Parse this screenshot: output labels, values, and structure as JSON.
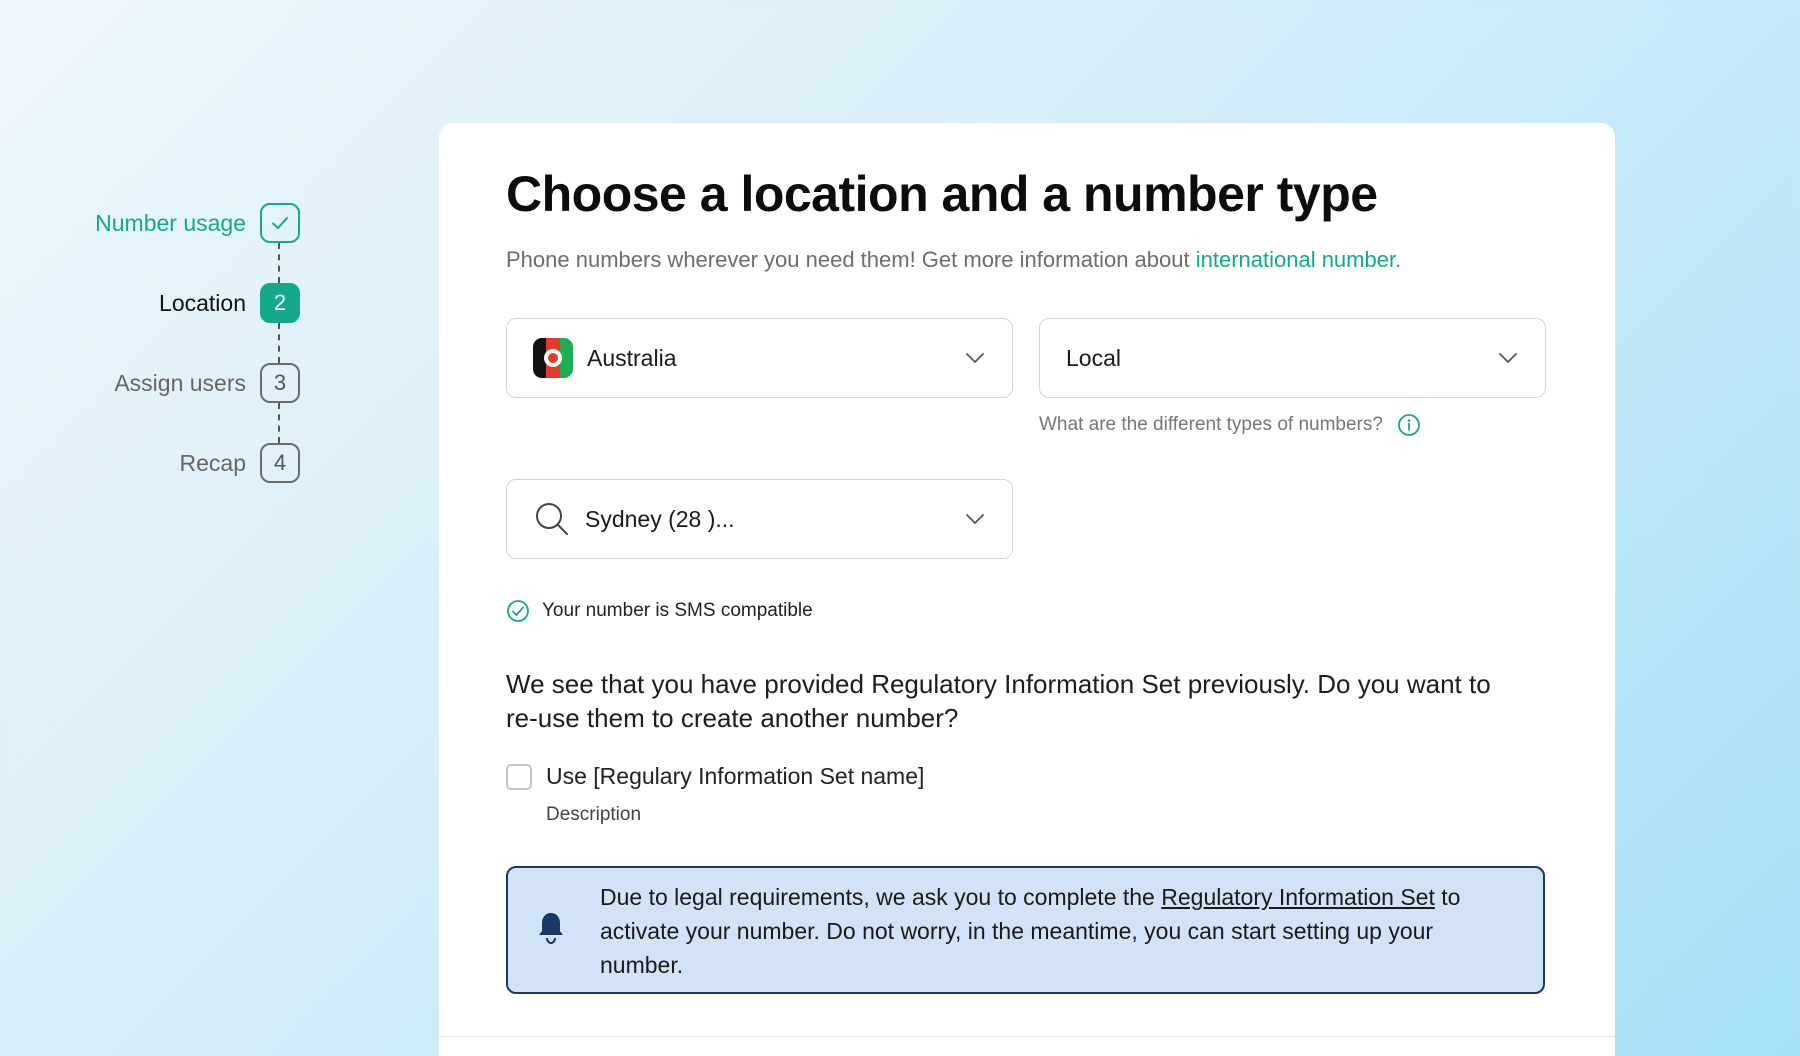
{
  "stepper": {
    "steps": [
      {
        "label": "Number usage",
        "badge": "",
        "state": "done"
      },
      {
        "label": "Location",
        "badge": "2",
        "state": "current"
      },
      {
        "label": "Assign users",
        "badge": "3",
        "state": "todo"
      },
      {
        "label": "Recap",
        "badge": "4",
        "state": "todo"
      }
    ]
  },
  "page": {
    "title": "Choose a location and a number type",
    "subtitle": "Phone numbers wherever you need them! Get more information about ",
    "subtitle_link": "international number."
  },
  "country_select": {
    "value": "Australia",
    "icon": "flag-icon"
  },
  "type_select": {
    "value": "Local"
  },
  "type_hint": {
    "text": "What are the different types of numbers?",
    "icon": "info-icon"
  },
  "city_select": {
    "value": "Sydney (28 )...",
    "icon": "search-icon"
  },
  "sms": {
    "text": "Your number is SMS compatible",
    "icon": "check-circle-icon"
  },
  "question": "We see that you have provided Regulatory Information Set previously. Do you want to re-use them to create another number?",
  "reuse": {
    "label": "Use [Regulary Information Set name]",
    "description": "Description",
    "checked": false
  },
  "alert": {
    "text_before": "Due to legal requirements, we ask you to complete the ",
    "link": "Regulatory Information Set",
    "text_after": " to activate your number. Do not worry, in the meantime, you can start setting up your number.",
    "icon": "bell-icon"
  },
  "colors": {
    "accent": "#14a98a",
    "alert_bg": "#d2e3f7",
    "alert_border": "#173a63"
  }
}
